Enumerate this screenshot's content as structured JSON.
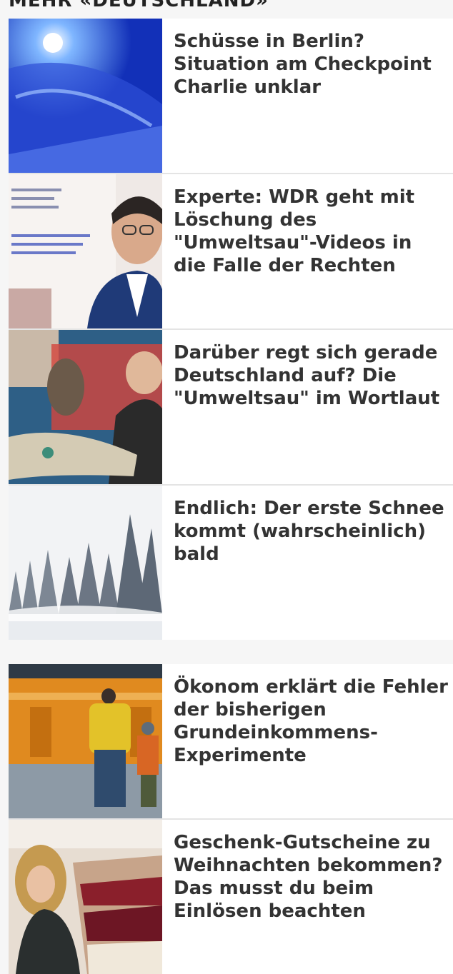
{
  "section": {
    "title": "MEHR «DEUTSCHLAND»"
  },
  "articles": [
    {
      "headline": "Schüsse in Berlin? Situation am Checkpoint Charlie unklar",
      "image": "police-car-blue-light"
    },
    {
      "headline": "Experte: WDR geht mit Löschung des \"Umweltsau\"-Videos in die Falle der Rechten",
      "image": "man-with-glasses-portrait"
    },
    {
      "headline": "Darüber regt sich gerade Deutschland auf? Die \"Umweltsau\" im Wortlaut",
      "image": "grandmother-collage"
    },
    {
      "headline": "Endlich: Der erste Schnee kommt (wahrscheinlich) bald",
      "image": "snowy-forest"
    },
    {
      "headline": "Ökonom erklärt die Fehler der bisherigen Grundeinkommens-Experimente",
      "image": "subway-platform-father-child"
    },
    {
      "headline": "Geschenk-Gutscheine zu Weihnachten bekommen? Das musst du beim Einlösen beachten",
      "image": "woman-clothing-rack"
    }
  ]
}
